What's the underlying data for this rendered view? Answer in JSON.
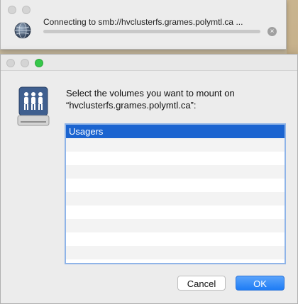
{
  "progress_window": {
    "status_text": "Connecting to smb://hvclusterfs.grames.polymtl.ca ...",
    "progress_fraction": 0.0,
    "stop_symbol": "×",
    "icon": "network-globe-icon"
  },
  "mount_dialog": {
    "icon": "shared-drive-icon",
    "prompt_line1": "Select the volumes you want to mount on",
    "prompt_line2": "“hvclusterfs.grames.polymtl.ca”:",
    "volumes": [
      {
        "label": "Usagers",
        "selected": true
      },
      {
        "label": ""
      },
      {
        "label": ""
      },
      {
        "label": ""
      },
      {
        "label": ""
      },
      {
        "label": ""
      },
      {
        "label": ""
      },
      {
        "label": ""
      },
      {
        "label": ""
      },
      {
        "label": ""
      }
    ],
    "cancel_label": "Cancel",
    "ok_label": "OK"
  },
  "colors": {
    "selection": "#1b64d0",
    "ok_button": "#1e7cf5",
    "zoom_button": "#35c749"
  }
}
